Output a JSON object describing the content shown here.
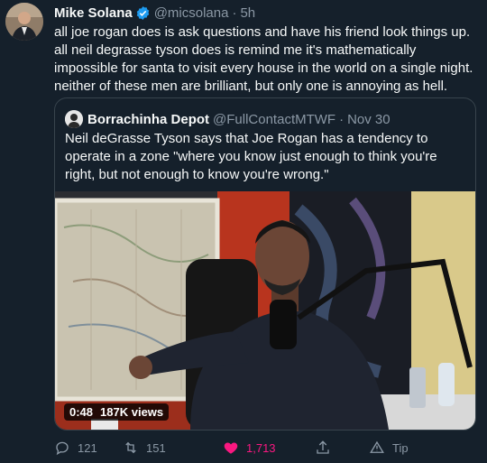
{
  "tweet": {
    "author_name": "Mike Solana",
    "author_handle": "@micsolana",
    "separator": "·",
    "time": "5h",
    "text": "all joe rogan does is ask questions and have his friend look things up. all neil degrasse tyson does is remind me it's mathematically impossible for santa to visit every house in the world on a single night. neither of these men are brilliant, but only one is annoying as hell."
  },
  "quote": {
    "author_name": "Borrachinha Depot",
    "author_handle": "@FullContactMTWF",
    "separator": "·",
    "date": "Nov 30",
    "text": "Neil deGrasse Tyson says that Joe Rogan has a tendency to operate in a zone \"where you know just enough to think you're right, but not enough to know you're wrong.\"",
    "video": {
      "duration": "0:48",
      "views": "187K views"
    }
  },
  "actions": {
    "replies": "121",
    "retweets": "151",
    "likes": "1,713",
    "tip_label": "Tip"
  },
  "colors": {
    "background": "#15202b",
    "secondary_text": "#8b98a5",
    "verified_blue": "#1d9bf0",
    "like_pink": "#f91880"
  }
}
